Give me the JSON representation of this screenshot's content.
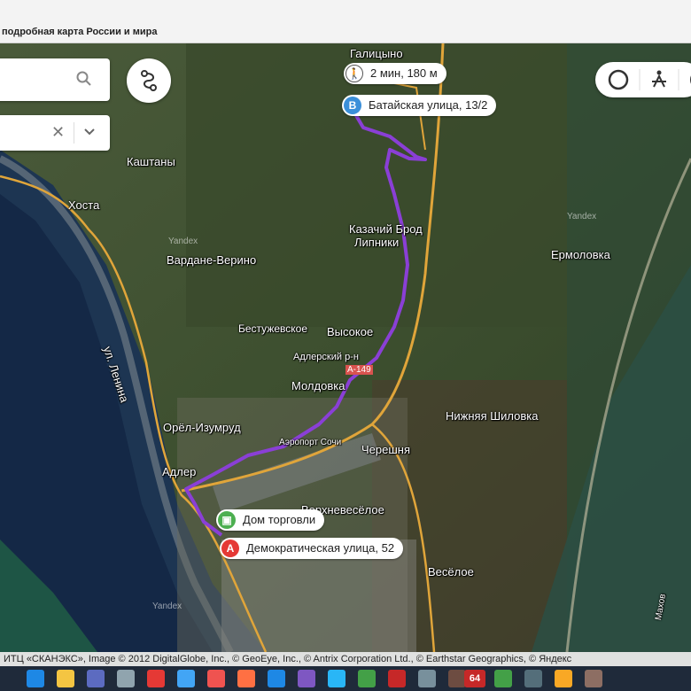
{
  "browser": {
    "tab_title": "подробная карта России и мира"
  },
  "map": {
    "labels": {
      "galitsyno": "Галицыно",
      "kashtany": "Каштаны",
      "khosta": "Хоста",
      "kazachiy_brod": "Казачий Брод",
      "lipniki": "Липники",
      "vardane": "Вардане-Верино",
      "ermolovka": "Ермоловка",
      "bestuzhevskoe": "Бестужевское",
      "vysokoe": "Высокое",
      "ul_lenina": "ул. Ленина",
      "adlersky": "Адлерский р-н",
      "a149": "А-149",
      "moldovka": "Молдовка",
      "nizhnyaya_shilovka": "Нижняя Шиловка",
      "orel_izumrud": "Орёл-Изумруд",
      "chereshnya": "Черешня",
      "adler": "Адлер",
      "aeroport": "Аэропорт Сочи",
      "verkhnevesyoloe": "Верхневесёлое",
      "vesyoloe": "Весёлое",
      "yandex1": "Yandex",
      "yandex2": "Yandex",
      "yandex3": "Yandex",
      "makhov": "Махов"
    },
    "walk_info": "2 мин, 180 м",
    "point_b": {
      "badge": "B",
      "label": "Батайская улица, 13/2"
    },
    "bus_stop": {
      "label": "Дом торговли"
    },
    "point_a": {
      "badge": "A",
      "label": "Демократическая улица, 52"
    },
    "colors": {
      "route": "#8a3fd6",
      "road": "#e0a53a",
      "point_a": "#e53935",
      "point_b": "#3b8fd9",
      "bus": "#4caf50"
    }
  },
  "copyright": "ИТЦ «СКАНЭКС», Image © 2012 DigitalGlobe, Inc., © GeoEye, Inc., © Antrix Corporation Ltd., © Earthstar Geographics, © Яндекс",
  "taskbar": {
    "badge_64": "64"
  }
}
